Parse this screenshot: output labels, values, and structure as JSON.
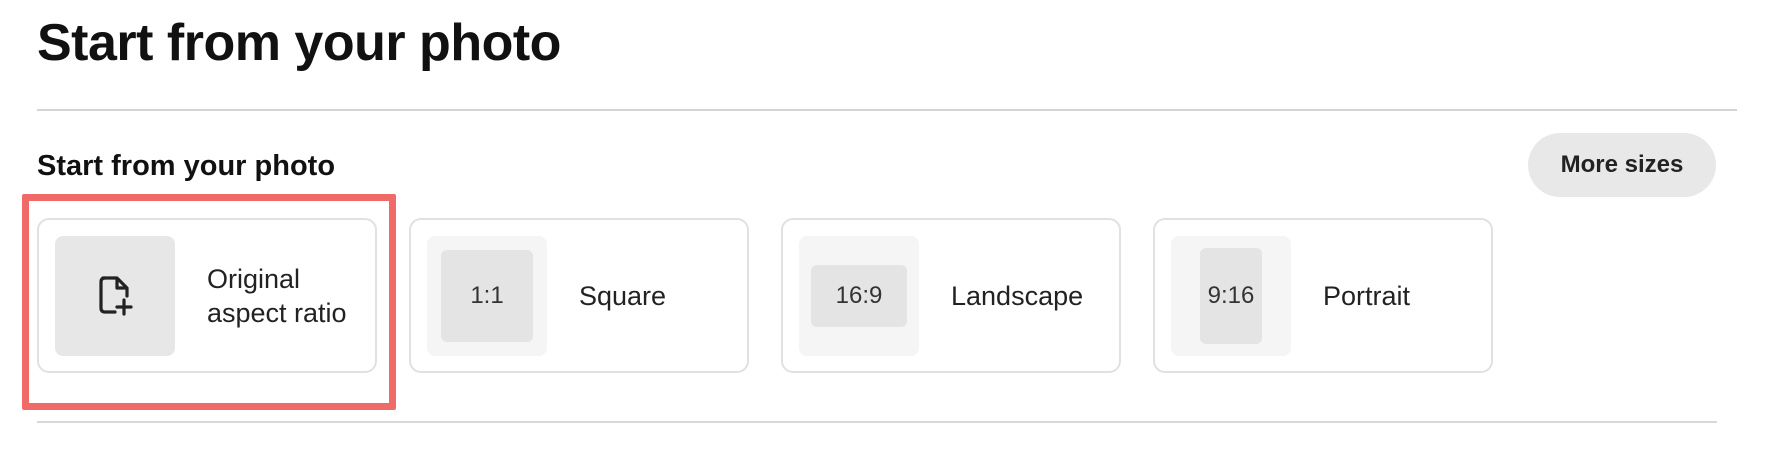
{
  "page": {
    "title": "Start from your photo"
  },
  "section": {
    "title": "Start from your photo",
    "more_sizes_label": "More sizes"
  },
  "cards": [
    {
      "label": "Original aspect ratio",
      "icon": "add-file-icon"
    },
    {
      "label": "Square",
      "ratio": "1:1"
    },
    {
      "label": "Landscape",
      "ratio": "16:9"
    },
    {
      "label": "Portrait",
      "ratio": "9:16"
    }
  ],
  "highlight_color": "#f06a67"
}
